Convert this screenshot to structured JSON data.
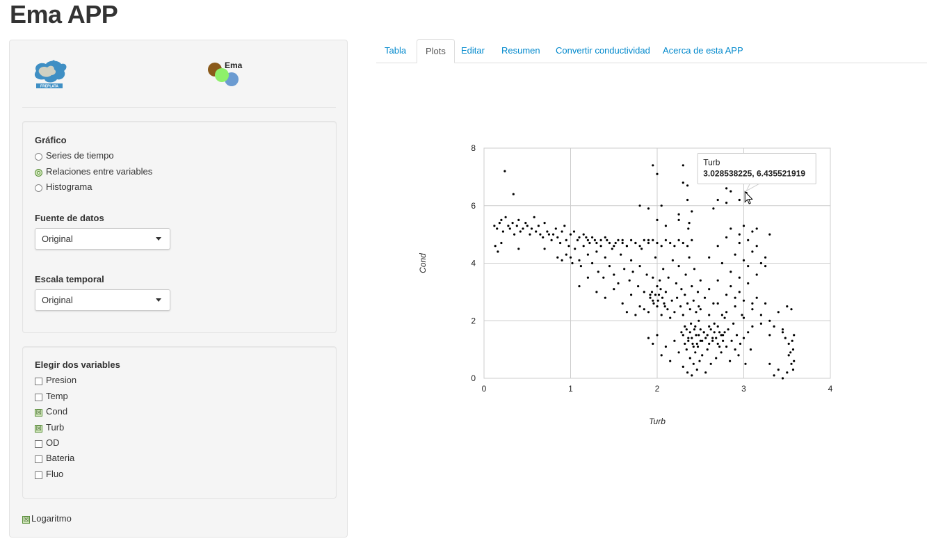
{
  "app": {
    "title": "Ema APP"
  },
  "logos": {
    "freplata": "FREPLATA",
    "ema": "Ema"
  },
  "tabs": [
    {
      "label": "Tabla",
      "active": false
    },
    {
      "label": "Plots",
      "active": true
    },
    {
      "label": "Editar",
      "active": false
    },
    {
      "label": "Resumen",
      "active": false
    },
    {
      "label": "Convertir conductividad",
      "active": false
    },
    {
      "label": "Acerca de esta APP",
      "active": false
    }
  ],
  "grafico": {
    "label": "Gráfico",
    "options": [
      {
        "label": "Series de tiempo",
        "selected": false
      },
      {
        "label": "Relaciones entre variables",
        "selected": true
      },
      {
        "label": "Histograma",
        "selected": false
      }
    ]
  },
  "fuente": {
    "label": "Fuente de datos",
    "value": "Original"
  },
  "escala": {
    "label": "Escala temporal",
    "value": "Original"
  },
  "variables": {
    "label": "Elegir dos variables",
    "items": [
      {
        "label": "Presion",
        "checked": false
      },
      {
        "label": "Temp",
        "checked": false
      },
      {
        "label": "Cond",
        "checked": true
      },
      {
        "label": "Turb",
        "checked": true
      },
      {
        "label": "OD",
        "checked": false
      },
      {
        "label": "Bateria",
        "checked": false
      },
      {
        "label": "Fluo",
        "checked": false
      }
    ]
  },
  "logaritmo": {
    "label": "Logaritmo",
    "checked": true
  },
  "colors": {
    "link": "#0088cc",
    "check_fill": "#cfe6b8",
    "check_border": "#5a8f3a",
    "points": "#000000"
  },
  "tooltip": {
    "series": "Turb",
    "value": "3.028538225, 6.435521919"
  },
  "chart_data": {
    "type": "scatter",
    "xlabel": "Turb",
    "ylabel": "Cond",
    "xlim": [
      0,
      4
    ],
    "ylim": [
      0,
      8
    ],
    "xticks": [
      "0",
      "1",
      "2",
      "3",
      "4"
    ],
    "yticks": [
      "0",
      "2",
      "4",
      "6",
      "8"
    ],
    "grid": true,
    "highlight_point": [
      3.03,
      6.44
    ],
    "points": [
      [
        0.12,
        5.3
      ],
      [
        0.15,
        5.2
      ],
      [
        0.18,
        5.4
      ],
      [
        0.2,
        5.5
      ],
      [
        0.22,
        5.1
      ],
      [
        0.25,
        5.6
      ],
      [
        0.28,
        5.3
      ],
      [
        0.3,
        5.2
      ],
      [
        0.33,
        5.4
      ],
      [
        0.35,
        5.0
      ],
      [
        0.38,
        5.3
      ],
      [
        0.4,
        5.5
      ],
      [
        0.42,
        5.1
      ],
      [
        0.45,
        5.2
      ],
      [
        0.48,
        5.4
      ],
      [
        0.5,
        5.3
      ],
      [
        0.53,
        5.0
      ],
      [
        0.55,
        5.2
      ],
      [
        0.58,
        5.6
      ],
      [
        0.6,
        5.1
      ],
      [
        0.63,
        5.3
      ],
      [
        0.65,
        5.0
      ],
      [
        0.68,
        4.9
      ],
      [
        0.7,
        5.4
      ],
      [
        0.73,
        5.1
      ],
      [
        0.75,
        5.0
      ],
      [
        0.78,
        4.8
      ],
      [
        0.8,
        5.0
      ],
      [
        0.83,
        5.2
      ],
      [
        0.85,
        4.9
      ],
      [
        0.88,
        4.7
      ],
      [
        0.9,
        5.1
      ],
      [
        0.93,
        5.3
      ],
      [
        0.95,
        4.8
      ],
      [
        0.98,
        4.6
      ],
      [
        1.0,
        5.0
      ],
      [
        0.13,
        4.6
      ],
      [
        0.16,
        4.4
      ],
      [
        0.2,
        4.7
      ],
      [
        0.24,
        7.2
      ],
      [
        0.34,
        6.4
      ],
      [
        0.4,
        4.5
      ],
      [
        0.7,
        4.5
      ],
      [
        0.85,
        4.2
      ],
      [
        0.9,
        4.1
      ],
      [
        0.95,
        4.3
      ],
      [
        1.0,
        4.2
      ],
      [
        1.02,
        4.0
      ],
      [
        1.05,
        4.5
      ],
      [
        1.08,
        4.8
      ],
      [
        1.1,
        4.1
      ],
      [
        1.12,
        3.9
      ],
      [
        1.15,
        4.6
      ],
      [
        1.18,
        4.9
      ],
      [
        1.2,
        4.3
      ],
      [
        1.22,
        4.7
      ],
      [
        1.25,
        4.0
      ],
      [
        1.28,
        4.8
      ],
      [
        1.3,
        4.4
      ],
      [
        1.32,
        3.7
      ],
      [
        1.35,
        4.6
      ],
      [
        1.38,
        3.5
      ],
      [
        1.4,
        4.2
      ],
      [
        1.42,
        4.8
      ],
      [
        1.45,
        3.9
      ],
      [
        1.48,
        4.5
      ],
      [
        1.5,
        3.6
      ],
      [
        1.52,
        4.7
      ],
      [
        1.55,
        3.3
      ],
      [
        1.58,
        4.3
      ],
      [
        1.6,
        4.8
      ],
      [
        1.62,
        3.8
      ],
      [
        1.65,
        4.6
      ],
      [
        1.68,
        3.4
      ],
      [
        1.7,
        4.1
      ],
      [
        1.72,
        3.7
      ],
      [
        1.75,
        4.7
      ],
      [
        1.78,
        3.2
      ],
      [
        1.8,
        3.9
      ],
      [
        1.82,
        4.5
      ],
      [
        1.85,
        3.0
      ],
      [
        1.88,
        3.6
      ],
      [
        1.9,
        4.8
      ],
      [
        1.92,
        2.9
      ],
      [
        1.95,
        3.5
      ],
      [
        1.98,
        4.2
      ],
      [
        1.04,
        5.1
      ],
      [
        1.1,
        4.9
      ],
      [
        1.15,
        5.0
      ],
      [
        1.2,
        4.8
      ],
      [
        1.25,
        4.9
      ],
      [
        1.3,
        4.7
      ],
      [
        1.35,
        4.8
      ],
      [
        1.4,
        4.9
      ],
      [
        1.45,
        4.7
      ],
      [
        1.5,
        4.6
      ],
      [
        1.55,
        4.8
      ],
      [
        1.6,
        4.7
      ],
      [
        1.65,
        4.6
      ],
      [
        1.7,
        4.8
      ],
      [
        1.75,
        4.7
      ],
      [
        1.8,
        4.6
      ],
      [
        1.85,
        4.8
      ],
      [
        1.9,
        4.7
      ],
      [
        1.95,
        4.8
      ],
      [
        2.0,
        4.7
      ],
      [
        2.05,
        4.6
      ],
      [
        2.1,
        4.8
      ],
      [
        2.15,
        4.7
      ],
      [
        2.2,
        4.6
      ],
      [
        2.25,
        4.8
      ],
      [
        2.3,
        4.7
      ],
      [
        2.35,
        4.6
      ],
      [
        2.4,
        4.8
      ],
      [
        1.1,
        3.2
      ],
      [
        1.2,
        3.5
      ],
      [
        1.3,
        3.0
      ],
      [
        1.4,
        2.8
      ],
      [
        1.5,
        3.1
      ],
      [
        1.6,
        2.6
      ],
      [
        1.7,
        2.9
      ],
      [
        1.8,
        2.5
      ],
      [
        1.9,
        2.3
      ],
      [
        1.95,
        2.7
      ],
      [
        1.85,
        2.4
      ],
      [
        1.75,
        2.2
      ],
      [
        1.65,
        2.3
      ],
      [
        2.0,
        3.2
      ],
      [
        2.0,
        2.5
      ],
      [
        2.02,
        2.9
      ],
      [
        2.03,
        3.4
      ],
      [
        2.05,
        2.2
      ],
      [
        2.07,
        3.8
      ],
      [
        2.08,
        2.6
      ],
      [
        2.1,
        3.0
      ],
      [
        2.12,
        2.4
      ],
      [
        2.13,
        3.5
      ],
      [
        2.15,
        2.1
      ],
      [
        2.17,
        2.7
      ],
      [
        2.18,
        4.1
      ],
      [
        2.2,
        2.3
      ],
      [
        2.22,
        3.3
      ],
      [
        2.23,
        2.8
      ],
      [
        2.25,
        3.9
      ],
      [
        2.27,
        2.5
      ],
      [
        2.28,
        3.1
      ],
      [
        2.3,
        2.2
      ],
      [
        2.32,
        2.9
      ],
      [
        2.33,
        3.6
      ],
      [
        2.35,
        2.6
      ],
      [
        2.37,
        4.2
      ],
      [
        2.38,
        2.4
      ],
      [
        2.4,
        3.2
      ],
      [
        2.42,
        2.7
      ],
      [
        2.43,
        3.8
      ],
      [
        2.45,
        2.3
      ],
      [
        2.47,
        3.0
      ],
      [
        2.48,
        2.5
      ],
      [
        2.5,
        3.4
      ],
      [
        1.92,
        2.8
      ],
      [
        1.94,
        3.0
      ],
      [
        1.96,
        2.6
      ],
      [
        1.98,
        2.9
      ],
      [
        2.01,
        2.7
      ],
      [
        2.04,
        3.1
      ],
      [
        2.06,
        2.8
      ],
      [
        2.09,
        2.5
      ],
      [
        1.9,
        1.4
      ],
      [
        1.95,
        1.2
      ],
      [
        2.0,
        1.5
      ],
      [
        2.05,
        0.8
      ],
      [
        2.1,
        1.1
      ],
      [
        2.15,
        0.6
      ],
      [
        2.2,
        1.3
      ],
      [
        2.25,
        0.9
      ],
      [
        2.28,
        1.6
      ],
      [
        2.3,
        0.4
      ],
      [
        2.32,
        1.8
      ],
      [
        2.34,
        1.0
      ],
      [
        2.35,
        0.2
      ],
      [
        2.36,
        1.4
      ],
      [
        2.38,
        0.7
      ],
      [
        2.39,
        1.9
      ],
      [
        2.4,
        0.1
      ],
      [
        2.41,
        1.2
      ],
      [
        2.42,
        0.5
      ],
      [
        2.43,
        1.7
      ],
      [
        2.44,
        0.9
      ],
      [
        2.45,
        1.5
      ],
      [
        2.46,
        0.3
      ],
      [
        2.47,
        1.1
      ],
      [
        2.48,
        2.0
      ],
      [
        2.49,
        0.6
      ],
      [
        2.5,
        1.3
      ],
      [
        2.52,
        0.8
      ],
      [
        2.54,
        1.6
      ],
      [
        2.56,
        0.2
      ],
      [
        2.58,
        1.0
      ],
      [
        2.6,
        1.8
      ],
      [
        2.62,
        0.5
      ],
      [
        2.64,
        1.4
      ],
      [
        2.66,
        1.9
      ],
      [
        2.68,
        0.7
      ],
      [
        2.7,
        1.2
      ],
      [
        2.72,
        1.6
      ],
      [
        2.74,
        0.9
      ],
      [
        2.76,
        1.5
      ],
      [
        2.78,
        2.1
      ],
      [
        2.8,
        1.1
      ],
      [
        2.82,
        1.7
      ],
      [
        2.84,
        0.6
      ],
      [
        2.86,
        1.3
      ],
      [
        2.88,
        1.9
      ],
      [
        2.9,
        1.0
      ],
      [
        2.92,
        1.5
      ],
      [
        2.94,
        0.8
      ],
      [
        2.96,
        1.2
      ],
      [
        2.98,
        2.2
      ],
      [
        3.0,
        1.4
      ],
      [
        3.02,
        0.5
      ],
      [
        3.05,
        1.6
      ],
      [
        3.08,
        1.0
      ],
      [
        3.1,
        1.8
      ],
      [
        2.3,
        1.5
      ],
      [
        2.32,
        1.2
      ],
      [
        2.34,
        1.7
      ],
      [
        2.36,
        1.3
      ],
      [
        2.38,
        1.6
      ],
      [
        2.4,
        1.4
      ],
      [
        2.42,
        1.1
      ],
      [
        2.44,
        1.8
      ],
      [
        2.46,
        1.2
      ],
      [
        2.48,
        1.5
      ],
      [
        2.5,
        1.7
      ],
      [
        2.52,
        1.3
      ],
      [
        2.54,
        1.6
      ],
      [
        2.56,
        1.4
      ],
      [
        2.58,
        1.5
      ],
      [
        2.6,
        1.2
      ],
      [
        2.62,
        1.7
      ],
      [
        2.64,
        1.3
      ],
      [
        2.66,
        1.6
      ],
      [
        2.68,
        1.4
      ],
      [
        2.7,
        1.8
      ],
      [
        2.72,
        1.1
      ],
      [
        2.74,
        1.5
      ],
      [
        2.76,
        1.3
      ],
      [
        2.78,
        1.6
      ],
      [
        2.5,
        2.4
      ],
      [
        2.55,
        2.8
      ],
      [
        2.6,
        3.1
      ],
      [
        2.65,
        2.6
      ],
      [
        2.7,
        3.4
      ],
      [
        2.75,
        2.2
      ],
      [
        2.8,
        2.9
      ],
      [
        2.85,
        3.2
      ],
      [
        2.9,
        2.5
      ],
      [
        2.95,
        3.0
      ],
      [
        3.0,
        2.7
      ],
      [
        3.05,
        3.3
      ],
      [
        3.1,
        2.4
      ],
      [
        3.15,
        2.8
      ],
      [
        3.2,
        2.2
      ],
      [
        3.25,
        2.6
      ],
      [
        3.3,
        2.0
      ],
      [
        3.35,
        1.8
      ],
      [
        3.4,
        2.3
      ],
      [
        3.45,
        1.6
      ],
      [
        2.6,
        2.2
      ],
      [
        2.7,
        2.6
      ],
      [
        2.8,
        2.3
      ],
      [
        2.9,
        2.8
      ],
      [
        3.0,
        2.1
      ],
      [
        3.1,
        2.6
      ],
      [
        3.2,
        1.9
      ],
      [
        3.3,
        1.5
      ],
      [
        2.85,
        3.7
      ],
      [
        2.95,
        3.5
      ],
      [
        3.05,
        3.9
      ],
      [
        3.15,
        3.6
      ],
      [
        2.6,
        4.2
      ],
      [
        2.7,
        4.6
      ],
      [
        2.75,
        4.0
      ],
      [
        2.8,
        4.9
      ],
      [
        2.9,
        4.3
      ],
      [
        2.95,
        4.7
      ],
      [
        3.0,
        4.1
      ],
      [
        3.05,
        4.8
      ],
      [
        3.1,
        4.4
      ],
      [
        3.15,
        4.6
      ],
      [
        3.2,
        4.0
      ],
      [
        3.25,
        4.2
      ],
      [
        2.85,
        5.2
      ],
      [
        2.95,
        5.0
      ],
      [
        3.0,
        5.3
      ],
      [
        3.1,
        5.1
      ],
      [
        3.15,
        5.2
      ],
      [
        3.25,
        3.9
      ],
      [
        3.3,
        5.0
      ],
      [
        3.3,
        0.5
      ],
      [
        3.35,
        0.1
      ],
      [
        3.4,
        0.3
      ],
      [
        3.45,
        0.0
      ],
      [
        3.5,
        0.2
      ],
      [
        3.52,
        0.8
      ],
      [
        3.55,
        0.5
      ],
      [
        3.56,
        1.3
      ],
      [
        3.57,
        1.0
      ],
      [
        3.58,
        0.6
      ],
      [
        3.55,
        2.4
      ],
      [
        3.5,
        2.5
      ],
      [
        3.45,
        1.7
      ],
      [
        3.48,
        1.4
      ],
      [
        3.52,
        1.2
      ],
      [
        3.54,
        0.9
      ],
      [
        3.57,
        0.3
      ],
      [
        3.58,
        1.5
      ],
      [
        1.95,
        7.4
      ],
      [
        2.0,
        7.1
      ],
      [
        2.3,
        7.4
      ],
      [
        2.3,
        6.8
      ],
      [
        2.35,
        6.7
      ],
      [
        2.65,
        7.6
      ],
      [
        2.8,
        6.6
      ],
      [
        2.85,
        6.5
      ],
      [
        2.95,
        6.8
      ],
      [
        2.7,
        6.2
      ],
      [
        2.65,
        5.9
      ],
      [
        2.05,
        6.0
      ],
      [
        2.25,
        5.5
      ],
      [
        2.35,
        6.2
      ],
      [
        2.4,
        5.8
      ],
      [
        2.8,
        6.1
      ],
      [
        2.95,
        6.2
      ],
      [
        1.8,
        6.0
      ],
      [
        1.9,
        5.9
      ],
      [
        2.0,
        5.5
      ],
      [
        2.1,
        5.3
      ],
      [
        2.25,
        5.7
      ],
      [
        2.37,
        5.4
      ],
      [
        2.36,
        5.2
      ],
      [
        3.03,
        6.44
      ]
    ]
  }
}
